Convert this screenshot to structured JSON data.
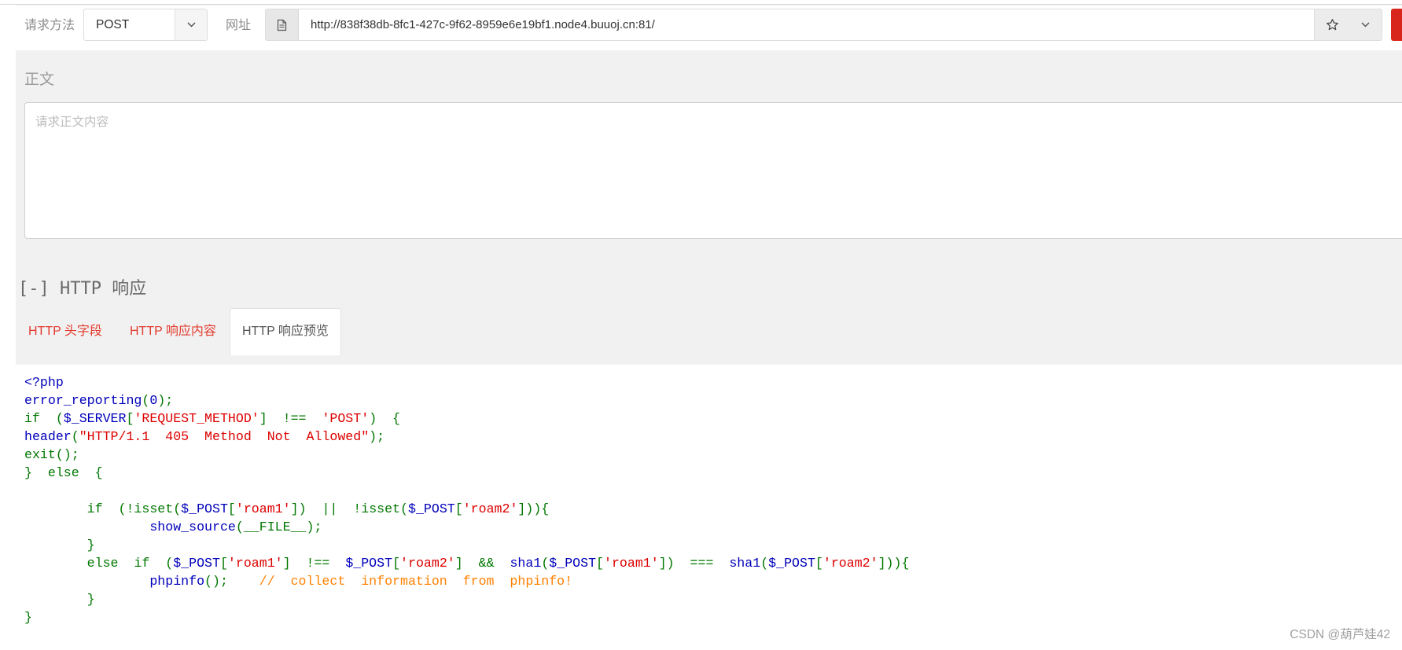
{
  "toolbar": {
    "method_label": "请求方法",
    "method_value": "POST",
    "url_label": "网址",
    "url_value": "http://838f38db-8fc1-427c-9f62-8959e6e19bf1.node4.buuoj.cn:81/"
  },
  "body": {
    "heading": "正文",
    "placeholder": "请求正文内容"
  },
  "response": {
    "heading": "[-] HTTP 响应",
    "tabs": [
      {
        "label": "HTTP 头字段",
        "active": false
      },
      {
        "label": "HTTP 响应内容",
        "active": false
      },
      {
        "label": "HTTP 响应预览",
        "active": true
      }
    ],
    "code_lines": [
      [
        {
          "k": "default",
          "t": "<?php"
        }
      ],
      [
        {
          "k": "default",
          "t": "error_reporting"
        },
        {
          "k": "keyword",
          "t": "("
        },
        {
          "k": "default",
          "t": "0"
        },
        {
          "k": "keyword",
          "t": ");"
        }
      ],
      [
        {
          "k": "keyword",
          "t": "if  ("
        },
        {
          "k": "default",
          "t": "$_SERVER"
        },
        {
          "k": "keyword",
          "t": "["
        },
        {
          "k": "string",
          "t": "'REQUEST_METHOD'"
        },
        {
          "k": "keyword",
          "t": "]  !==  "
        },
        {
          "k": "string",
          "t": "'POST'"
        },
        {
          "k": "keyword",
          "t": ")  {"
        }
      ],
      [
        {
          "k": "default",
          "t": "header"
        },
        {
          "k": "keyword",
          "t": "("
        },
        {
          "k": "string",
          "t": "\"HTTP/1.1  405  Method  Not  Allowed\""
        },
        {
          "k": "keyword",
          "t": ");"
        }
      ],
      [
        {
          "k": "keyword",
          "t": "exit();"
        }
      ],
      [
        {
          "k": "keyword",
          "t": "}  else  {"
        }
      ],
      [],
      [
        {
          "k": "keyword",
          "t": "        if  (!isset("
        },
        {
          "k": "default",
          "t": "$_POST"
        },
        {
          "k": "keyword",
          "t": "["
        },
        {
          "k": "string",
          "t": "'roam1'"
        },
        {
          "k": "keyword",
          "t": "])  ||  !isset("
        },
        {
          "k": "default",
          "t": "$_POST"
        },
        {
          "k": "keyword",
          "t": "["
        },
        {
          "k": "string",
          "t": "'roam2'"
        },
        {
          "k": "keyword",
          "t": "])){"
        }
      ],
      [
        {
          "k": "default",
          "t": "                show_source"
        },
        {
          "k": "keyword",
          "t": "(__FILE__);"
        }
      ],
      [
        {
          "k": "keyword",
          "t": "        }"
        }
      ],
      [
        {
          "k": "keyword",
          "t": "        else  if  ("
        },
        {
          "k": "default",
          "t": "$_POST"
        },
        {
          "k": "keyword",
          "t": "["
        },
        {
          "k": "string",
          "t": "'roam1'"
        },
        {
          "k": "keyword",
          "t": "]  !==  "
        },
        {
          "k": "default",
          "t": "$_POST"
        },
        {
          "k": "keyword",
          "t": "["
        },
        {
          "k": "string",
          "t": "'roam2'"
        },
        {
          "k": "keyword",
          "t": "]  &&  "
        },
        {
          "k": "default",
          "t": "sha1"
        },
        {
          "k": "keyword",
          "t": "("
        },
        {
          "k": "default",
          "t": "$_POST"
        },
        {
          "k": "keyword",
          "t": "["
        },
        {
          "k": "string",
          "t": "'roam1'"
        },
        {
          "k": "keyword",
          "t": "])  ===  "
        },
        {
          "k": "default",
          "t": "sha1"
        },
        {
          "k": "keyword",
          "t": "("
        },
        {
          "k": "default",
          "t": "$_POST"
        },
        {
          "k": "keyword",
          "t": "["
        },
        {
          "k": "string",
          "t": "'roam2'"
        },
        {
          "k": "keyword",
          "t": "])){"
        }
      ],
      [
        {
          "k": "default",
          "t": "                phpinfo"
        },
        {
          "k": "keyword",
          "t": "();    "
        },
        {
          "k": "comment",
          "t": "//  collect  information  from  phpinfo!"
        }
      ],
      [
        {
          "k": "keyword",
          "t": "        }"
        }
      ],
      [
        {
          "k": "keyword",
          "t": "}"
        }
      ]
    ]
  },
  "watermark": "CSDN @葫芦娃42",
  "icons": {
    "method_toggle": "chevron-down-icon",
    "url_prefix": "document-icon",
    "bookmark": "star-icon",
    "url_toggle": "chevron-down-icon"
  },
  "colors": {
    "send_button": "#d9261c",
    "tab_link": "#e33b2f",
    "code": {
      "default": "#0000BB",
      "keyword": "#007700",
      "string": "#DD0000",
      "comment": "#FF8000"
    }
  }
}
